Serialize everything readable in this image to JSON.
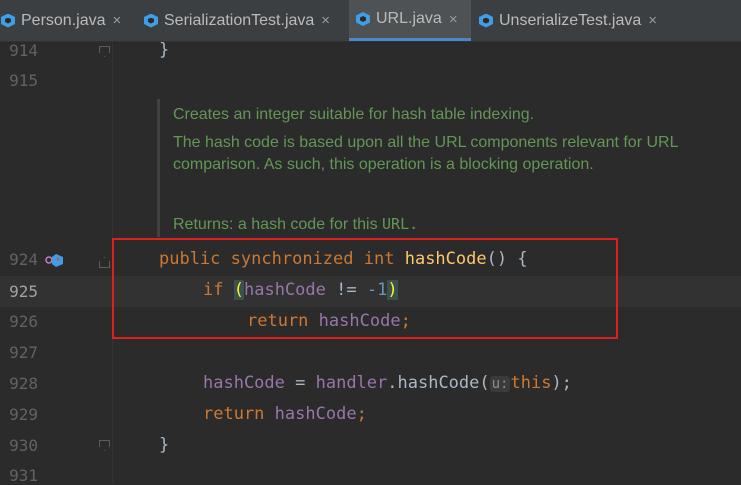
{
  "tabs": [
    {
      "label": "Person.java",
      "active": false
    },
    {
      "label": "SerializationTest.java",
      "active": false
    },
    {
      "label": "URL.java",
      "active": true
    },
    {
      "label": "UnserializeTest.java",
      "active": false
    }
  ],
  "close_glyph": "×",
  "line_numbers": {
    "l914": "914",
    "l915": "915",
    "l924": "924",
    "l925": "925",
    "l926": "926",
    "l927": "927",
    "l928": "928",
    "l929": "929",
    "l930": "930",
    "l931": "931"
  },
  "doc": {
    "line1": "Creates an integer suitable for hash table indexing.",
    "line2": "The hash code is based upon all the URL components relevant for URL",
    "line3": "comparison. As such, this operation is a blocking operation.",
    "returns_label": "Returns:",
    "returns_text": "a hash code for this",
    "returns_code": "URL."
  },
  "code": {
    "close_brace_914": "}",
    "kw_public": "public",
    "kw_synchronized": "synchronized",
    "kw_int": "int",
    "method_name": "hashCode",
    "sig_rest": "() {",
    "kw_if": "if",
    "paren_open": "(",
    "if_field": "hashCode",
    "if_op": " != ",
    "if_num": "-1",
    "paren_close": ")",
    "kw_return": "return",
    "return_field": "hashCode",
    "semicolon": ";",
    "assign_field": "hashCode",
    "assign_op": " = ",
    "handler_field": "handler",
    "dot_call": ".hashCode(",
    "param_hint": "u:",
    "kw_this": "this",
    "call_end": ");",
    "kw_return2": "return",
    "return2_field": "hashCode",
    "close_brace_930": "}"
  }
}
